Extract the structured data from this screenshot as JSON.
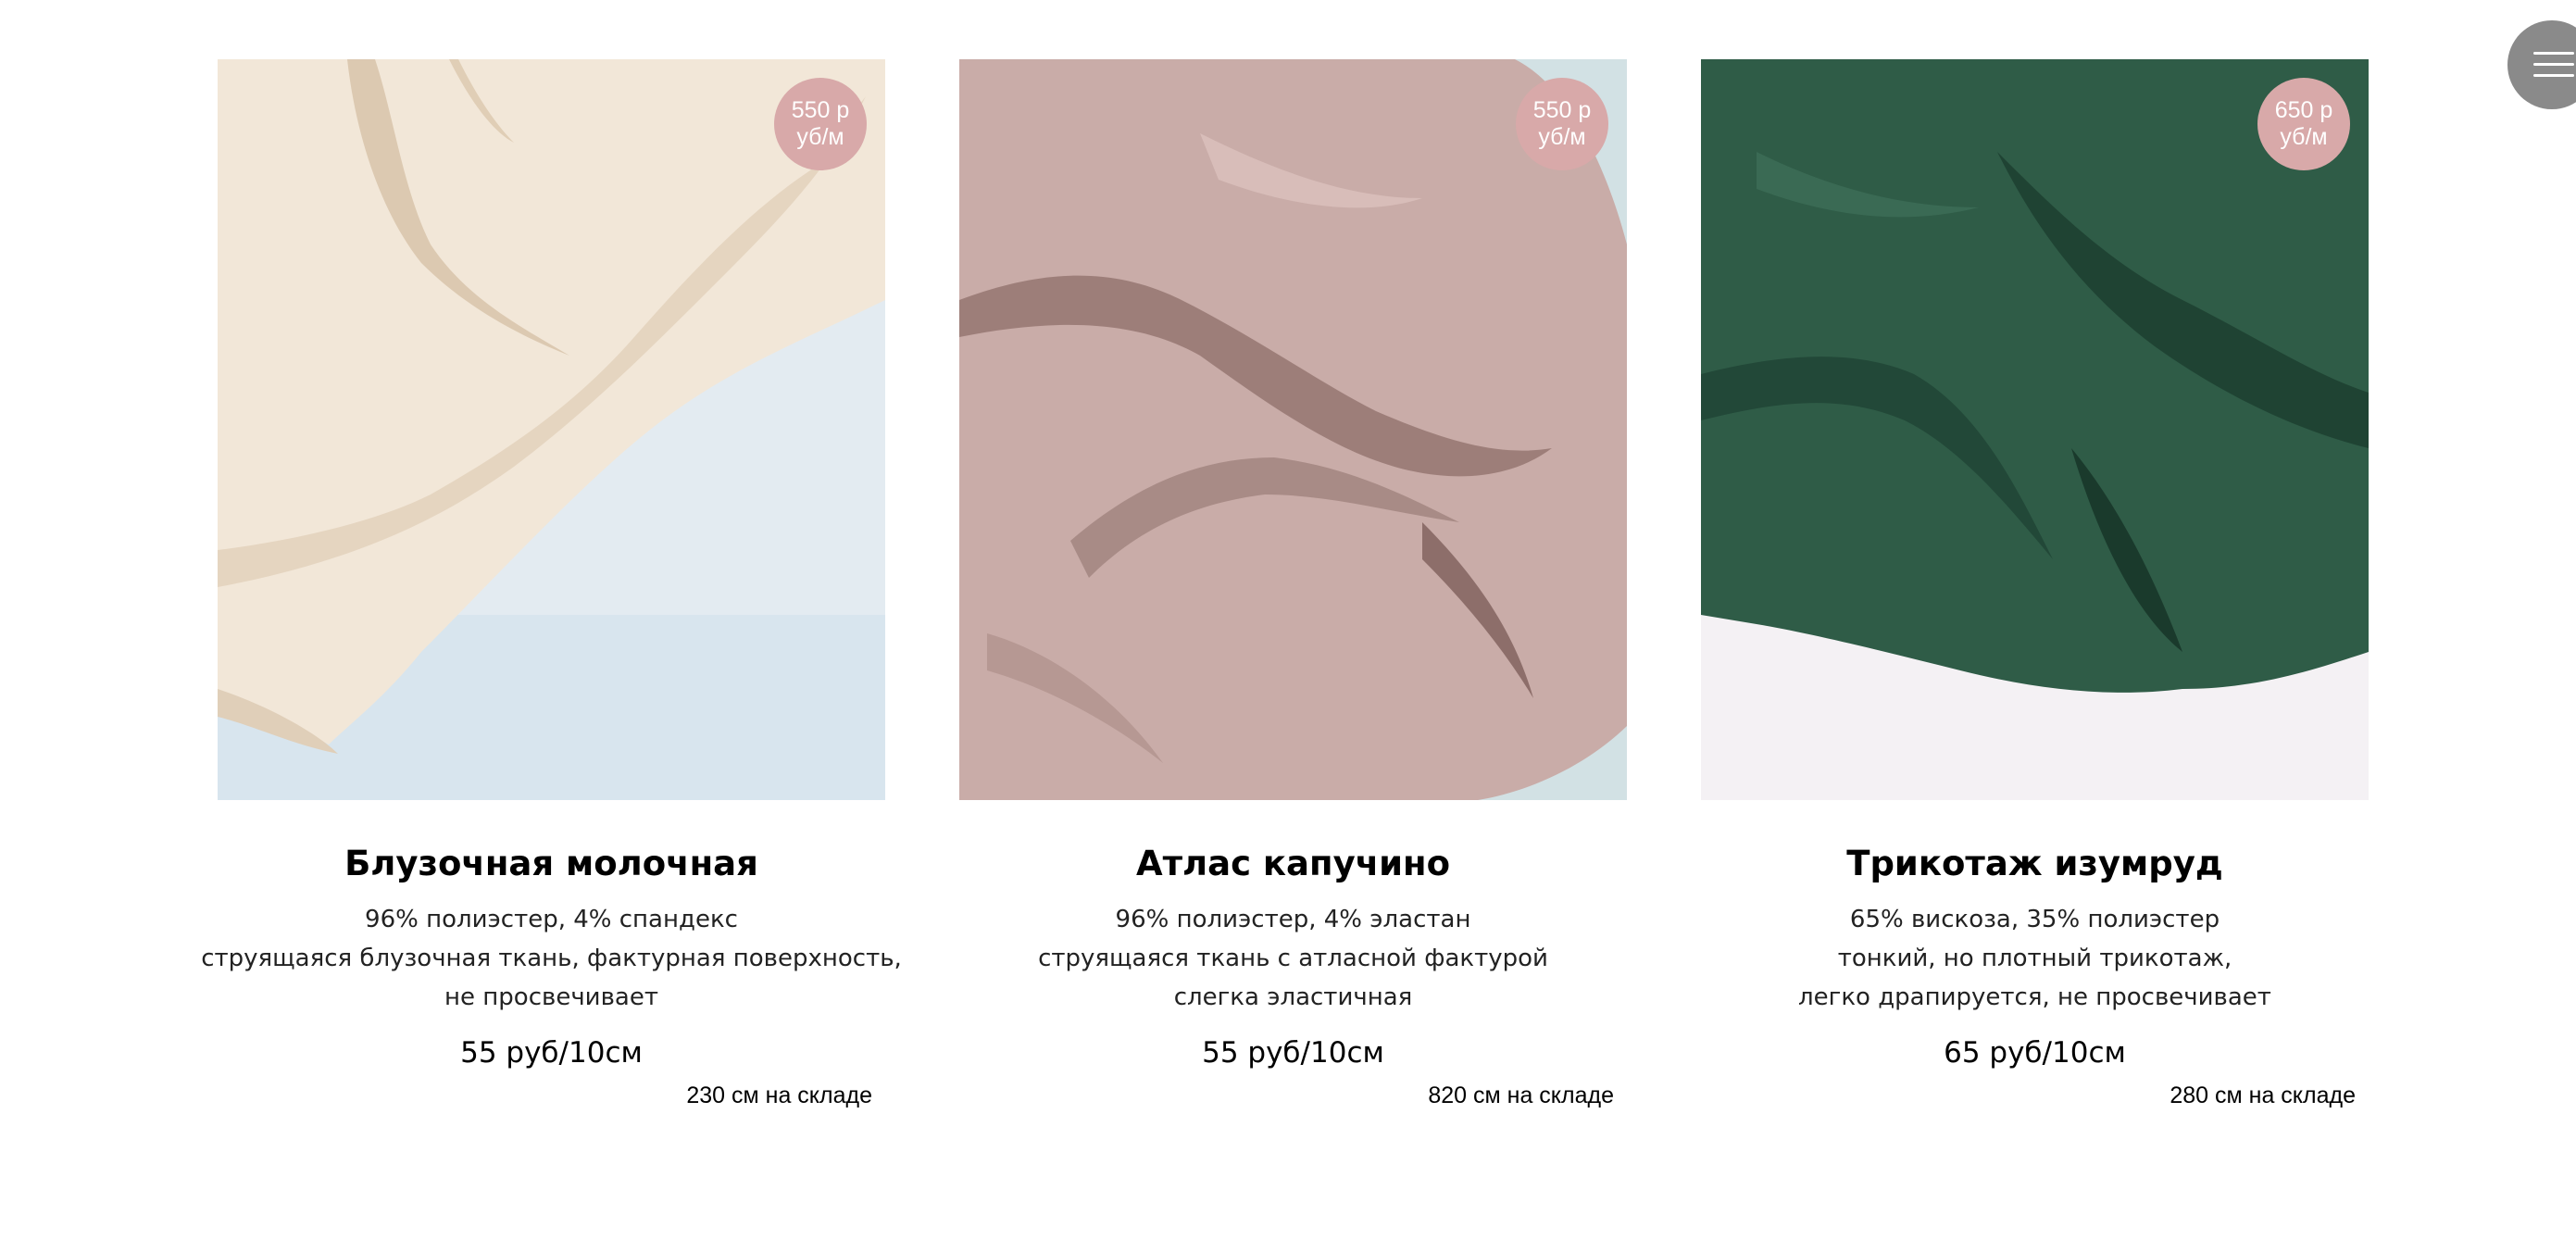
{
  "products": [
    {
      "badge": "550 руб/м",
      "title": "Блузочная молочная",
      "desc": [
        "96% полиэстер, 4% спандекс",
        "струящаяся блузочная ткань, фактурная поверхность,",
        "не просвечивает"
      ],
      "price": "55 руб/10см",
      "stock": "230 см на складе",
      "colors": {
        "fabric": "#f1e6d7",
        "shadow": "#d9c8b2",
        "background": "#dde6ee"
      }
    },
    {
      "badge": "550 руб/м",
      "title": "Атлас капучино",
      "desc": [
        "96% полиэстер, 4% эластан",
        "струящаяся ткань с атласной фактурой",
        "слегка эластичная"
      ],
      "price": "55 руб/10см",
      "stock": "820 см на складе",
      "colors": {
        "fabric": "#c8aaa6",
        "shadow": "#8f706c",
        "background": "#d6e3e6"
      }
    },
    {
      "badge": "650 руб/м",
      "title": "Трикотаж изумруд",
      "desc": [
        "65% вискоза, 35% полиэстер",
        "тонкий, но плотный трикотаж,",
        "легко драпируется, не просвечивает"
      ],
      "price": "65 руб/10см",
      "stock": "280 см на складе",
      "colors": {
        "fabric": "#2d5a45",
        "shadow": "#163526",
        "background": "#f3f0f3"
      }
    }
  ],
  "menu": {
    "icon": "hamburger-menu-icon",
    "color": "#8a8a8a"
  },
  "badge_color": "#d8a9a9"
}
